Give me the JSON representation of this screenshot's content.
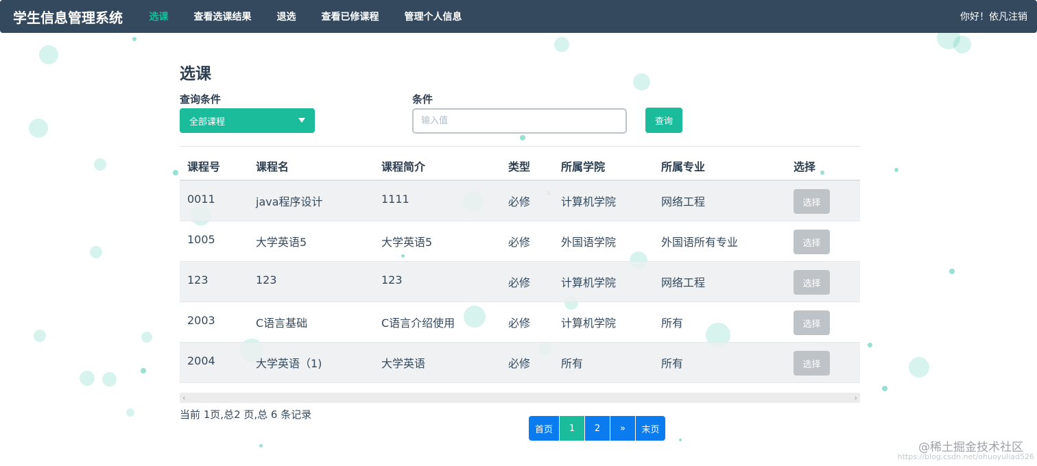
{
  "navbar": {
    "brand": "学生信息管理系统",
    "items": [
      {
        "label": "选课",
        "active": true
      },
      {
        "label": "查看选课结果",
        "active": false
      },
      {
        "label": "退选",
        "active": false
      },
      {
        "label": "查看已修课程",
        "active": false
      },
      {
        "label": "管理个人信息",
        "active": false
      }
    ],
    "greeting": "你好！依凡",
    "logout": "注销"
  },
  "page": {
    "title": "选课",
    "query_label": "查询条件",
    "query_select_value": "全部课程",
    "condition_label": "条件",
    "condition_placeholder": "输入值",
    "query_button": "查询"
  },
  "table": {
    "headers": [
      "课程号",
      "课程名",
      "课程简介",
      "类型",
      "所属学院",
      "所属专业",
      "选择"
    ],
    "rows": [
      [
        "0011",
        "java程序设计",
        "1111",
        "必修",
        "计算机学院",
        "网络工程",
        "选择"
      ],
      [
        "1005",
        "大学英语5",
        "大学英语5",
        "必修",
        "外国语学院",
        "外国语所有专业",
        "选择"
      ],
      [
        "123",
        "123",
        "123",
        "必修",
        "计算机学院",
        "网络工程",
        "选择"
      ],
      [
        "2003",
        "C语言基础",
        "C语言介绍使用",
        "必修",
        "计算机学院",
        "所有",
        "选择"
      ],
      [
        "2004",
        "大学英语（1)",
        "大学英语",
        "必修",
        "所有",
        "所有",
        "选择"
      ]
    ]
  },
  "summary": "当前 1页,总2 页,总 6 条记录",
  "pager": {
    "first": "首页",
    "pages": [
      "1",
      "2"
    ],
    "next": "»",
    "last": "末页",
    "current": "1"
  },
  "watermark": "@稀土掘金技术社区",
  "watermark_url": "https://blog.csdn.net/ohuoyuliad526",
  "colors": {
    "navbar_bg": "#34495e",
    "accent": "#1abc9c",
    "pager_blue": "#0a7cf0",
    "disabled_button": "#bdc3c7"
  }
}
